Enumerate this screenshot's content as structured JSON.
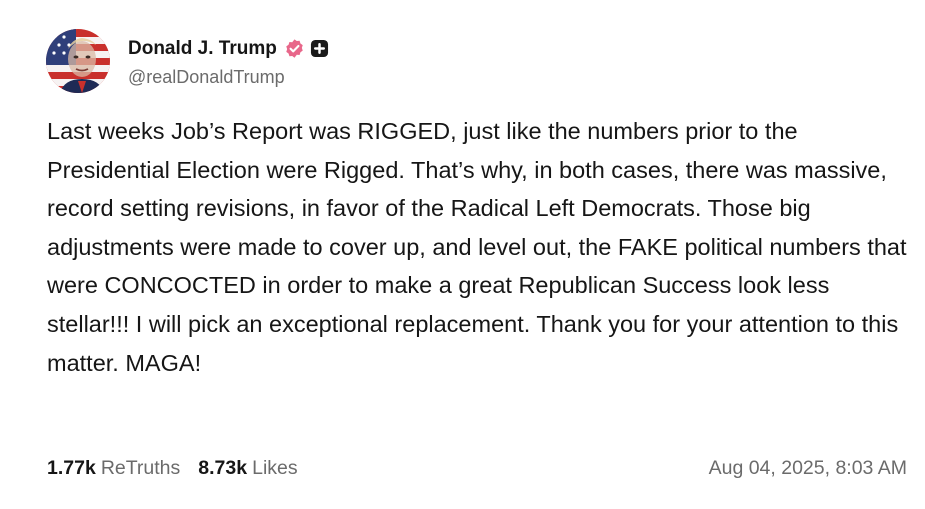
{
  "author": {
    "display_name": "Donald J. Trump",
    "handle": "@realDonaldTrump",
    "avatar_icon": "avatar-portrait-flag",
    "verified_icon": "verified-badge-icon",
    "verified_color": "#e8678a",
    "plus_icon": "plus-square-icon"
  },
  "post": {
    "text": "Last weeks Job’s Report was RIGGED, just like the numbers prior to the Presidential Election were Rigged. That’s why, in both cases, there was massive, record setting revisions, in favor of the Radical Left Democrats. Those big adjustments were made to cover up, and level out, the FAKE political numbers that were CONCOCTED in order to make a great Republican Success look less stellar!!! I will pick an exceptional replacement. Thank you for your attention to this matter. MAGA!"
  },
  "stats": {
    "retruths_count": "1.77k",
    "retruths_label": "ReTruths",
    "likes_count": "8.73k",
    "likes_label": "Likes"
  },
  "timestamp": "Aug 04, 2025, 8:03 AM"
}
